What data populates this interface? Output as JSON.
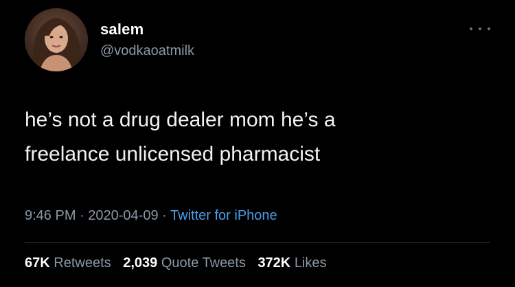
{
  "author": {
    "name": "salem",
    "handle": "@vodkaoatmilk"
  },
  "tweet": {
    "text": "he’s not a drug dealer mom he’s a\nfreelance unlicensed pharmacist",
    "time": "9:46 PM",
    "date": "2020-04-09",
    "separator": "·",
    "source": "Twitter for iPhone"
  },
  "stats": {
    "retweets": {
      "count": "67K",
      "label": "Retweets"
    },
    "quotes": {
      "count": "2,039",
      "label": "Quote Tweets"
    },
    "likes": {
      "count": "372K",
      "label": "Likes"
    }
  },
  "icons": {
    "more": "more-options-icon",
    "avatar": "avatar-photo"
  },
  "colors": {
    "background": "#000000",
    "text": "#f2f2f2",
    "secondary": "#8b98a5",
    "link": "#4a9ee6"
  }
}
